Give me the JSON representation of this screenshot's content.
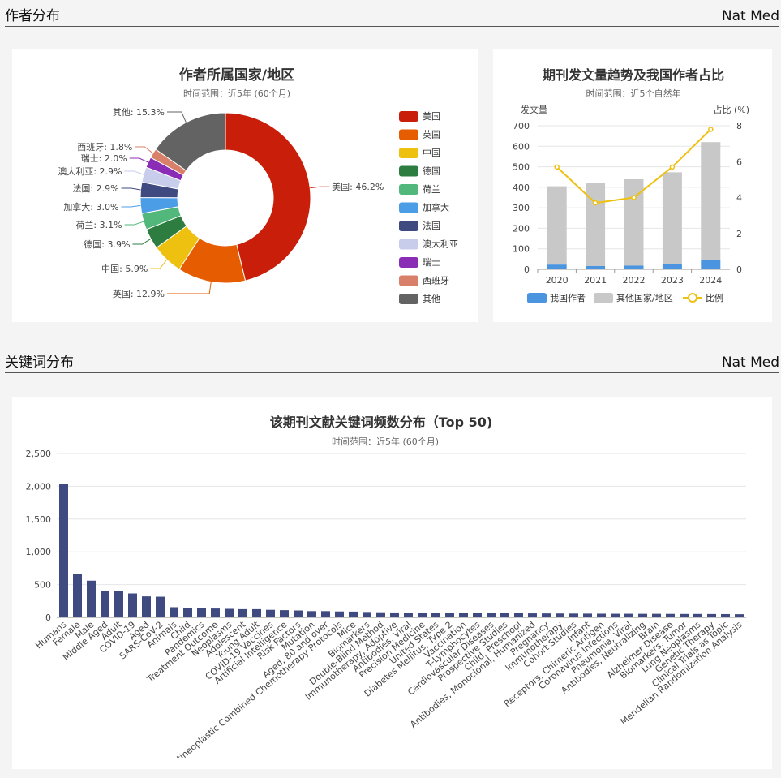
{
  "sections": {
    "authors": {
      "title": "作者分布",
      "journal": "Nat Med"
    },
    "keywords": {
      "title": "关键词分布",
      "journal": "Nat Med"
    }
  },
  "country_chart": {
    "title": "作者所属国家/地区",
    "subtitle": "时间范围：近5年 (60个月)"
  },
  "trend_chart": {
    "title": "期刊发文量趋势及我国作者占比",
    "subtitle": "时间范围：近5个自然年",
    "left_axis_label": "发文量",
    "right_axis_label": "占比 (%)"
  },
  "keyword_chart": {
    "title": "该期刊文献关键词频数分布（Top 50)",
    "subtitle": "时间范围：近5年 (60个月)"
  },
  "chart_data": [
    {
      "type": "pie",
      "title": "作者所属国家/地区",
      "subtitle": "时间范围：近5年 (60个月)",
      "legend_position": "right",
      "slices": [
        {
          "name": "美国",
          "value": 46.2,
          "label": "美国: 46.2%",
          "color": "#c81e0a"
        },
        {
          "name": "英国",
          "value": 12.9,
          "label": "英国: 12.9%",
          "color": "#e65c00"
        },
        {
          "name": "中国",
          "value": 5.9,
          "label": "中国: 5.9%",
          "color": "#eec00f"
        },
        {
          "name": "德国",
          "value": 3.9,
          "label": "德国: 3.9%",
          "color": "#2e7d40"
        },
        {
          "name": "荷兰",
          "value": 3.1,
          "label": "荷兰: 3.1%",
          "color": "#52b77a"
        },
        {
          "name": "加拿大",
          "value": 3.0,
          "label": "加拿大: 3.0%",
          "color": "#4b9ee6"
        },
        {
          "name": "法国",
          "value": 2.9,
          "label": "法国: 2.9%",
          "color": "#3f4a80"
        },
        {
          "name": "澳大利亚",
          "value": 2.9,
          "label": "澳大利亚: 2.9%",
          "color": "#c8cdeb"
        },
        {
          "name": "瑞士",
          "value": 2.0,
          "label": "瑞士: 2.0%",
          "color": "#8a2cb5"
        },
        {
          "name": "西班牙",
          "value": 1.8,
          "label": "西班牙: 1.8%",
          "color": "#d9806a"
        },
        {
          "name": "其他",
          "value": 15.3,
          "label": "其他: 15.3%",
          "color": "#636363"
        }
      ]
    },
    {
      "type": "bar",
      "stacked": true,
      "title": "期刊发文量趋势及我国作者占比",
      "subtitle": "时间范围：近5个自然年",
      "categories": [
        "2020",
        "2021",
        "2022",
        "2023",
        "2024"
      ],
      "ylabel": "发文量",
      "y2label": "占比 (%)",
      "ylim": [
        0,
        700
      ],
      "y2lim": [
        0,
        8
      ],
      "yticks": [
        "0",
        "100",
        "200",
        "300",
        "400",
        "500",
        "600",
        "700"
      ],
      "y2ticks": [
        "0",
        "2",
        "4",
        "6",
        "8"
      ],
      "legend_position": "bottom",
      "series": [
        {
          "name": "我国作者",
          "type": "bar",
          "color": "#4b94e0",
          "values": [
            23,
            16,
            18,
            27,
            44
          ]
        },
        {
          "name": "其他国家/地区",
          "type": "bar",
          "color": "#c8c8c8",
          "values": [
            382,
            405,
            421,
            446,
            576
          ]
        },
        {
          "name": "比例",
          "type": "line",
          "axis": "right",
          "color": "#eec00f",
          "values": [
            5.7,
            3.7,
            4.0,
            5.7,
            7.8
          ]
        }
      ]
    },
    {
      "type": "bar",
      "title": "该期刊文献关键词频数分布（Top 50)",
      "subtitle": "时间范围：近5年 (60个月)",
      "color": "#3f4a80",
      "ylim": [
        0,
        2500
      ],
      "yticks": [
        "0",
        "500",
        "1,000",
        "1,500",
        "2,000",
        "2,500"
      ],
      "categories": [
        "Humans",
        "Female",
        "Male",
        "Middle Aged",
        "Adult",
        "COVID-19",
        "Aged",
        "SARS-CoV-2",
        "Animals",
        "Child",
        "Pandemics",
        "Treatment Outcome",
        "Neoplasms",
        "Adolescent",
        "Young Adult",
        "COVID-19 Vaccines",
        "Artificial Intelligence",
        "Risk Factors",
        "Mutation",
        "Aged, 80 and over",
        "Antineoplastic Combined Chemotherapy Protocols",
        "Mice",
        "Biomarkers",
        "Double-Blind Method",
        "Immunotherapy, Adoptive",
        "Antibodies, Viral",
        "Precision Medicine",
        "United States",
        "Diabetes Mellitus, Type 2",
        "Vaccination",
        "T-Lymphocytes",
        "Cardiovascular Diseases",
        "Prospective Studies",
        "Child, Preschool",
        "Antibodies, Monoclonal, Humanized",
        "Pregnancy",
        "Immunotherapy",
        "Cohort Studies",
        "Infant",
        "Receptors, Chimeric Antigen",
        "Coronavirus Infections",
        "Pneumonia, Viral",
        "Antibodies, Neutralizing",
        "Brain",
        "Alzheimer Disease",
        "Biomarkers, Tumor",
        "Lung Neoplasms",
        "Genetic Therapy",
        "Clinical Trials as Topic",
        "Mendelian Randomization Analysis"
      ],
      "values": [
        2040,
        665,
        560,
        405,
        400,
        365,
        320,
        315,
        155,
        140,
        140,
        135,
        130,
        125,
        125,
        115,
        110,
        105,
        95,
        95,
        90,
        88,
        82,
        78,
        75,
        72,
        70,
        68,
        67,
        66,
        65,
        64,
        63,
        62,
        61,
        60,
        59,
        58,
        57,
        56,
        55,
        55,
        54,
        54,
        53,
        52,
        52,
        51,
        50,
        48
      ]
    }
  ]
}
